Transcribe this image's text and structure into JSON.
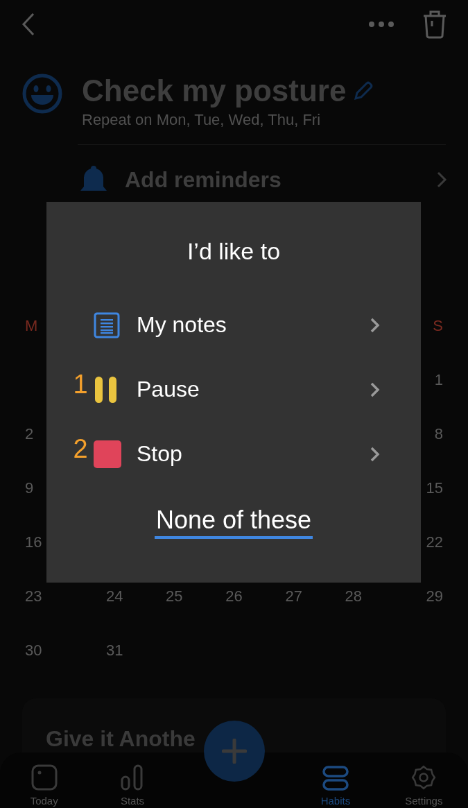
{
  "header": {
    "title": "Check my posture",
    "subtitle": "Repeat on Mon, Tue, Wed, Thu, Fri"
  },
  "reminders": {
    "label": "Add reminders"
  },
  "calendar": {
    "weekdays": {
      "first": "M",
      "last": "S"
    },
    "weeks": [
      {
        "last": "1"
      },
      {
        "first": "2",
        "last": "8"
      },
      {
        "first": "9",
        "last": "15"
      },
      {
        "first": "16",
        "last": "22"
      },
      {
        "days": [
          "23",
          "24",
          "25",
          "26",
          "27",
          "28",
          "29"
        ]
      },
      {
        "days": [
          "30",
          "31"
        ]
      }
    ]
  },
  "dialog": {
    "title": "I’d like to",
    "options": [
      {
        "kind": "notes",
        "label": "My notes"
      },
      {
        "kind": "pause",
        "label": "Pause",
        "number": "1"
      },
      {
        "kind": "stop",
        "label": "Stop",
        "number": "2"
      }
    ],
    "dismiss": "None of these"
  },
  "card": {
    "title": "Give it Anothe"
  },
  "nav": [
    {
      "kind": "today",
      "label": "Today",
      "selected": false
    },
    {
      "kind": "stats",
      "label": "Stats",
      "selected": false
    },
    {
      "kind": "habits",
      "label": "Habits",
      "selected": true
    },
    {
      "kind": "settings",
      "label": "Settings",
      "selected": false
    }
  ]
}
